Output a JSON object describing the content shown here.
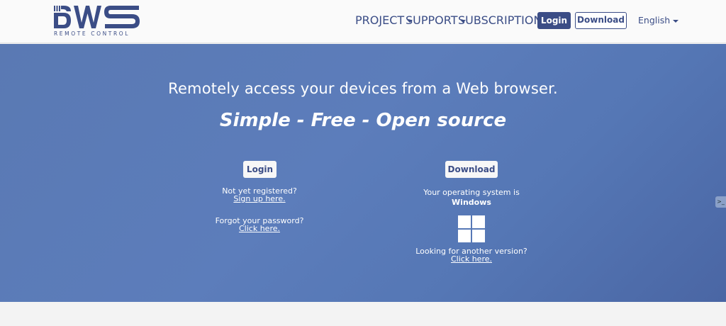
{
  "header": {
    "logo_sub": "REMOTE CONTROL",
    "nav": {
      "project": "PROJECT",
      "support": "SUPPORT",
      "subscriptions": "SUBSCRIPTIONS"
    },
    "login_label": "Login",
    "download_label": "Download",
    "language": "English"
  },
  "hero": {
    "title": "Remotely access your devices from a Web browser.",
    "subtitle": "Simple - Free - Open source",
    "login": {
      "button": "Login",
      "not_registered": "Not yet registered?",
      "signup_link": "Sign up here.",
      "forgot": "Forgot your password?",
      "forgot_link": "Click here."
    },
    "download": {
      "button": "Download",
      "os_text": "Your operating system is",
      "os_name": "Windows",
      "os_icon": "windows-icon",
      "another": "Looking for another version?",
      "another_link": "Click here."
    }
  },
  "side_tab": {
    "icon": "side-tab-icon"
  },
  "colors": {
    "brand": "#3b4d86",
    "hero_bg": "#5a79b3",
    "white": "#ffffff"
  }
}
